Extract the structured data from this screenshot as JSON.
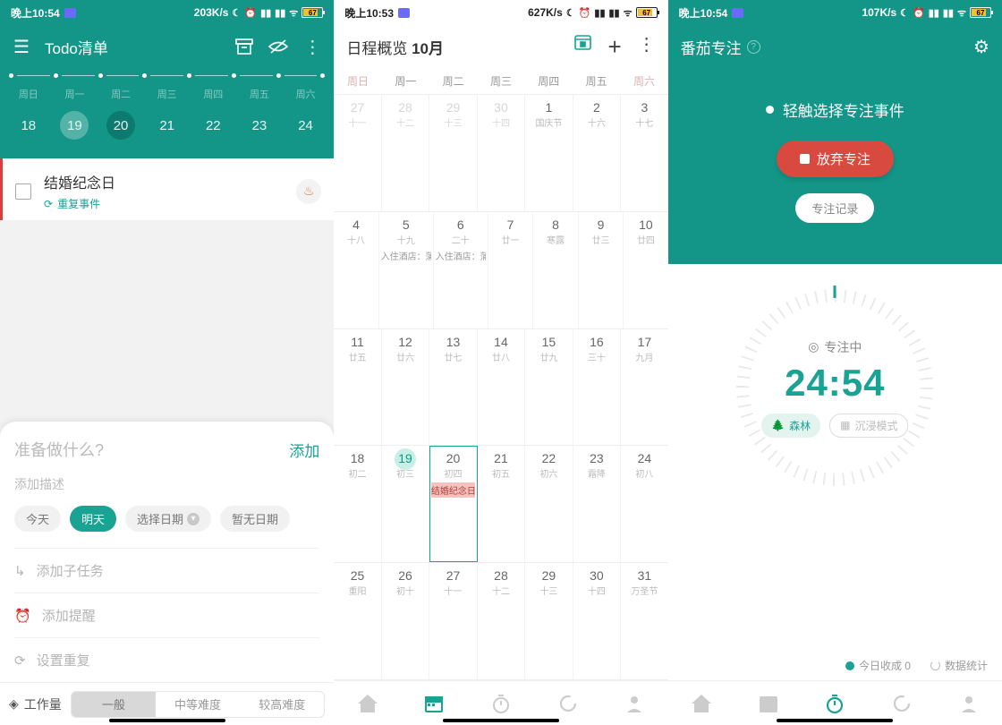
{
  "panel1": {
    "status": {
      "time": "晚上10:54",
      "rate": "203K/s",
      "battery": "67"
    },
    "appbar": {
      "title": "Todo清单"
    },
    "dow": [
      "周日",
      "周一",
      "周二",
      "周三",
      "周四",
      "周五",
      "周六"
    ],
    "days": [
      {
        "n": "18"
      },
      {
        "n": "19",
        "sel": true
      },
      {
        "n": "20",
        "today": true
      },
      {
        "n": "21"
      },
      {
        "n": "22"
      },
      {
        "n": "23"
      },
      {
        "n": "24"
      }
    ],
    "todo": {
      "title": "结婚纪念日",
      "repeat_label": "重复事件"
    },
    "sheet": {
      "placeholder": "准备做什么?",
      "add": "添加",
      "desc_placeholder": "添加描述",
      "chips": {
        "today": "今天",
        "tomorrow": "明天",
        "pick": "选择日期",
        "nodate": "暂无日期"
      },
      "subtask": "添加子任务",
      "reminder": "添加提醒",
      "repeat": "设置重复"
    },
    "workload": {
      "label": "工作量",
      "opts": [
        "一般",
        "中等难度",
        "较高难度"
      ]
    }
  },
  "panel2": {
    "status": {
      "time": "晚上10:53",
      "rate": "627K/s",
      "battery": "67"
    },
    "header": {
      "title": "日程概览",
      "month": "10月"
    },
    "dow": [
      "周日",
      "周一",
      "周二",
      "周三",
      "周四",
      "周五",
      "周六"
    ],
    "weeks": [
      [
        {
          "n": "27",
          "l": "十一",
          "out": true
        },
        {
          "n": "28",
          "l": "十二",
          "out": true
        },
        {
          "n": "29",
          "l": "十三",
          "out": true
        },
        {
          "n": "30",
          "l": "十四",
          "out": true
        },
        {
          "n": "1",
          "l": "国庆节"
        },
        {
          "n": "2",
          "l": "十六"
        },
        {
          "n": "3",
          "l": "十七"
        }
      ],
      [
        {
          "n": "4",
          "l": "十八"
        },
        {
          "n": "5",
          "l": "十九"
        },
        {
          "n": "6",
          "l": "二十"
        },
        {
          "n": "7",
          "l": "廿一"
        },
        {
          "n": "8",
          "l": "寒露"
        },
        {
          "n": "9",
          "l": "廿三"
        },
        {
          "n": "10",
          "l": "廿四"
        }
      ],
      [
        {
          "n": "11",
          "l": "廿五"
        },
        {
          "n": "12",
          "l": "廿六"
        },
        {
          "n": "13",
          "l": "廿七"
        },
        {
          "n": "14",
          "l": "廿八"
        },
        {
          "n": "15",
          "l": "廿九"
        },
        {
          "n": "16",
          "l": "三十"
        },
        {
          "n": "17",
          "l": "九月"
        }
      ],
      [
        {
          "n": "18",
          "l": "初二"
        },
        {
          "n": "19",
          "l": "初三",
          "todayCirc": true
        },
        {
          "n": "20",
          "l": "初四",
          "selBox": true,
          "evRed": "结婚纪念日"
        },
        {
          "n": "21",
          "l": "初五"
        },
        {
          "n": "22",
          "l": "初六"
        },
        {
          "n": "23",
          "l": "霜降"
        },
        {
          "n": "24",
          "l": "初八"
        }
      ],
      [
        {
          "n": "25",
          "l": "重阳"
        },
        {
          "n": "26",
          "l": "初十"
        },
        {
          "n": "27",
          "l": "十一"
        },
        {
          "n": "28",
          "l": "十二"
        },
        {
          "n": "29",
          "l": "十三"
        },
        {
          "n": "30",
          "l": "十四"
        },
        {
          "n": "31",
          "l": "万圣节"
        }
      ]
    ],
    "events": {
      "w1d1": "入住酒店：蒲",
      "w1d2": "入住酒店：蒲"
    }
  },
  "panel3": {
    "status": {
      "time": "晚上10:54",
      "rate": "107K/s",
      "battery": "67"
    },
    "title": "番茄专注",
    "select_event": "轻触选择专注事件",
    "abandon": "放弃专注",
    "record": "专注记录",
    "focusing": "专注中",
    "timer": "24:54",
    "modes": {
      "forest": "森林",
      "immersive": "沉浸模式"
    },
    "stats": {
      "today_income": "今日收成 0",
      "data_stat": "数据统计"
    }
  }
}
